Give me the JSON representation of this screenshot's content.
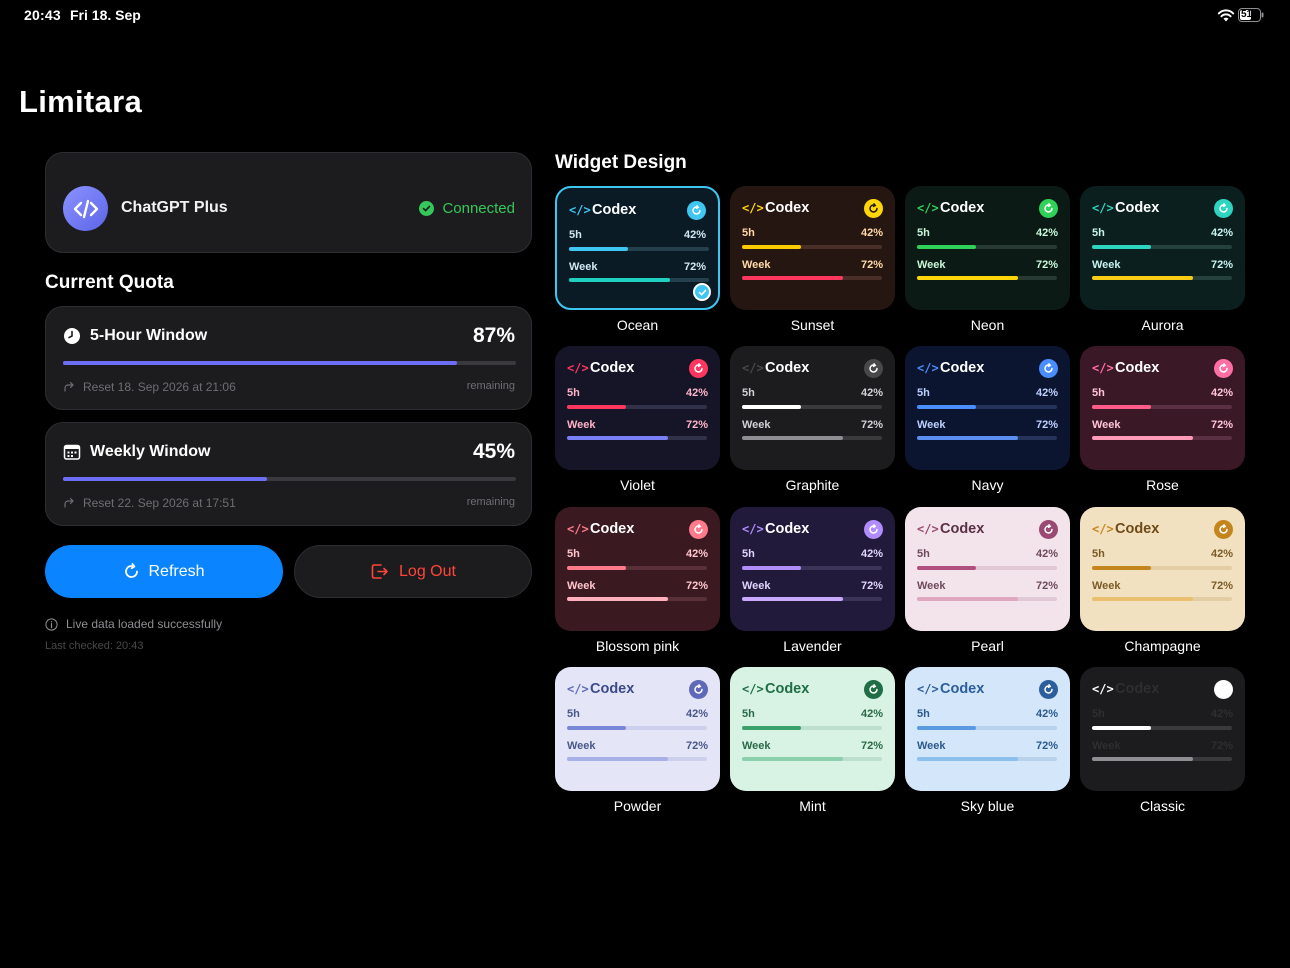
{
  "status_bar": {
    "time": "20:43",
    "date": "Fri 18. Sep",
    "battery": "51"
  },
  "app": {
    "title": "Limitara"
  },
  "account": {
    "name": "ChatGPT Plus",
    "status": "Connected"
  },
  "quota": {
    "title": "Current Quota",
    "windows": [
      {
        "label": "5-Hour Window",
        "percent": "87%",
        "fill": 0.87,
        "reset": "Reset 18. Sep 2026 at 21:06",
        "remaining": "remaining"
      },
      {
        "label": "Weekly Window",
        "percent": "45%",
        "fill": 0.45,
        "reset": "Reset 22. Sep 2026 at 17:51",
        "remaining": "remaining"
      }
    ]
  },
  "actions": {
    "refresh": "Refresh",
    "logout": "Log Out"
  },
  "info": {
    "message": "Live data loaded successfully",
    "last_checked": "Last checked: 20:43"
  },
  "widget_design": {
    "title": "Widget Design",
    "preview": {
      "title": "Codex",
      "row1_label": "5h",
      "row1_value": "42%",
      "row1_fill": 0.42,
      "row2_label": "Week",
      "row2_value": "72%",
      "row2_fill": 0.72
    },
    "themes": [
      {
        "name": "Ocean",
        "selected": true,
        "bg": "#0b1b26",
        "text": "#ffffff",
        "muted": "#cfe7f2",
        "accent": "#3fc6f2",
        "bar1": "#3fc6f2",
        "bar2": "#1fd1c1",
        "track": "#24404c",
        "badge_fg": "#ffffff"
      },
      {
        "name": "Sunset",
        "bg": "#261612",
        "text": "#ffffff",
        "muted": "#ffd8a8",
        "accent": "#ffd60a",
        "bar1": "#ffcc00",
        "bar2": "#ff375f",
        "track": "#4a2f28",
        "badge_fg": "#261612"
      },
      {
        "name": "Neon",
        "bg": "#0c1a16",
        "text": "#ffffff",
        "muted": "#c8f7d8",
        "accent": "#30d158",
        "bar1": "#30d158",
        "bar2": "#ffd60a",
        "track": "#263a33",
        "badge_fg": "#ffffff"
      },
      {
        "name": "Aurora",
        "bg": "#0a1f1e",
        "text": "#ffffff",
        "muted": "#c8f2ee",
        "accent": "#2dd4bf",
        "bar1": "#2dd4bf",
        "bar2": "#facc15",
        "track": "#24413e",
        "badge_fg": "#ffffff"
      },
      {
        "name": "Violet",
        "bg": "#161528",
        "text": "#ffffff",
        "muted": "#ffb3c6",
        "accent": "#ff375f",
        "bar1": "#ff375f",
        "bar2": "#7b7ff7",
        "track": "#32314a",
        "badge_fg": "#ffffff"
      },
      {
        "name": "Graphite",
        "bg": "#1c1c1e",
        "text": "#ffffff",
        "muted": "#d1d1d6",
        "accent": "#48484a",
        "bar1": "#ffffff",
        "bar2": "#8e8e93",
        "track": "#3a3a3c",
        "badge_fg": "#ffffff"
      },
      {
        "name": "Navy",
        "bg": "#0c1530",
        "text": "#ffffff",
        "muted": "#bcd0ff",
        "accent": "#4a8dff",
        "bar1": "#4a8dff",
        "bar2": "#5a8ef0",
        "track": "#26335a",
        "badge_fg": "#ffffff"
      },
      {
        "name": "Rose",
        "bg": "#3a1826",
        "text": "#ffffff",
        "muted": "#ffc4d6",
        "accent": "#ff6fa5",
        "bar1": "#ff5c8a",
        "bar2": "#ff9ab8",
        "track": "#5a3042",
        "badge_fg": "#ffffff"
      },
      {
        "name": "Blossom pink",
        "bg": "#3a1a20",
        "text": "#ffffff",
        "muted": "#ffc4cc",
        "accent": "#ff7a8a",
        "bar1": "#ff7a8a",
        "bar2": "#ffb0bc",
        "track": "#5a3038",
        "badge_fg": "#ffffff"
      },
      {
        "name": "Lavender",
        "bg": "#211a3a",
        "text": "#ffffff",
        "muted": "#e0d4ff",
        "accent": "#b18cff",
        "bar1": "#b18cff",
        "bar2": "#c9a8ff",
        "track": "#3c3458",
        "badge_fg": "#ffffff"
      },
      {
        "name": "Pearl",
        "bg": "#f2e4ea",
        "text": "#5a3046",
        "muted": "#6e4a5c",
        "accent": "#9a4a72",
        "bar1": "#b0507e",
        "bar2": "#e0a8c0",
        "track": "#e0c8d4",
        "badge_fg": "#ffffff"
      },
      {
        "name": "Champagne",
        "bg": "#f2e1c0",
        "text": "#6e4a18",
        "muted": "#7a5a28",
        "accent": "#c4861c",
        "bar1": "#c4861c",
        "bar2": "#e8c070",
        "track": "#e2cda4",
        "badge_fg": "#ffffff"
      },
      {
        "name": "Powder",
        "bg": "#e4e6f8",
        "text": "#3c4a8a",
        "muted": "#4a5888",
        "accent": "#5e6ab8",
        "bar1": "#7a86d8",
        "bar2": "#a8b0e8",
        "track": "#cdd0ec",
        "badge_fg": "#ffffff"
      },
      {
        "name": "Mint",
        "bg": "#d8f2e4",
        "text": "#1f6e46",
        "muted": "#2a6a48",
        "accent": "#1f6e46",
        "bar1": "#3aa06c",
        "bar2": "#8ad0ac",
        "track": "#bde0ce",
        "badge_fg": "#ffffff"
      },
      {
        "name": "Sky blue",
        "bg": "#d4e6fa",
        "text": "#2c5e9c",
        "muted": "#2c5a8c",
        "accent": "#2c5e9c",
        "bar1": "#5a9ae0",
        "bar2": "#8ec0ee",
        "track": "#b8d2ec",
        "badge_fg": "#ffffff"
      },
      {
        "name": "Classic",
        "bg": "#1c1c1e",
        "text": "#2e2e30",
        "muted": "#2e2e30",
        "accent": "#ffffff",
        "bar1": "#ffffff",
        "bar2": "#8e8e93",
        "track": "#3a3a3c",
        "badge_fg": "#ffffff",
        "logo": "#ffffff"
      }
    ]
  }
}
